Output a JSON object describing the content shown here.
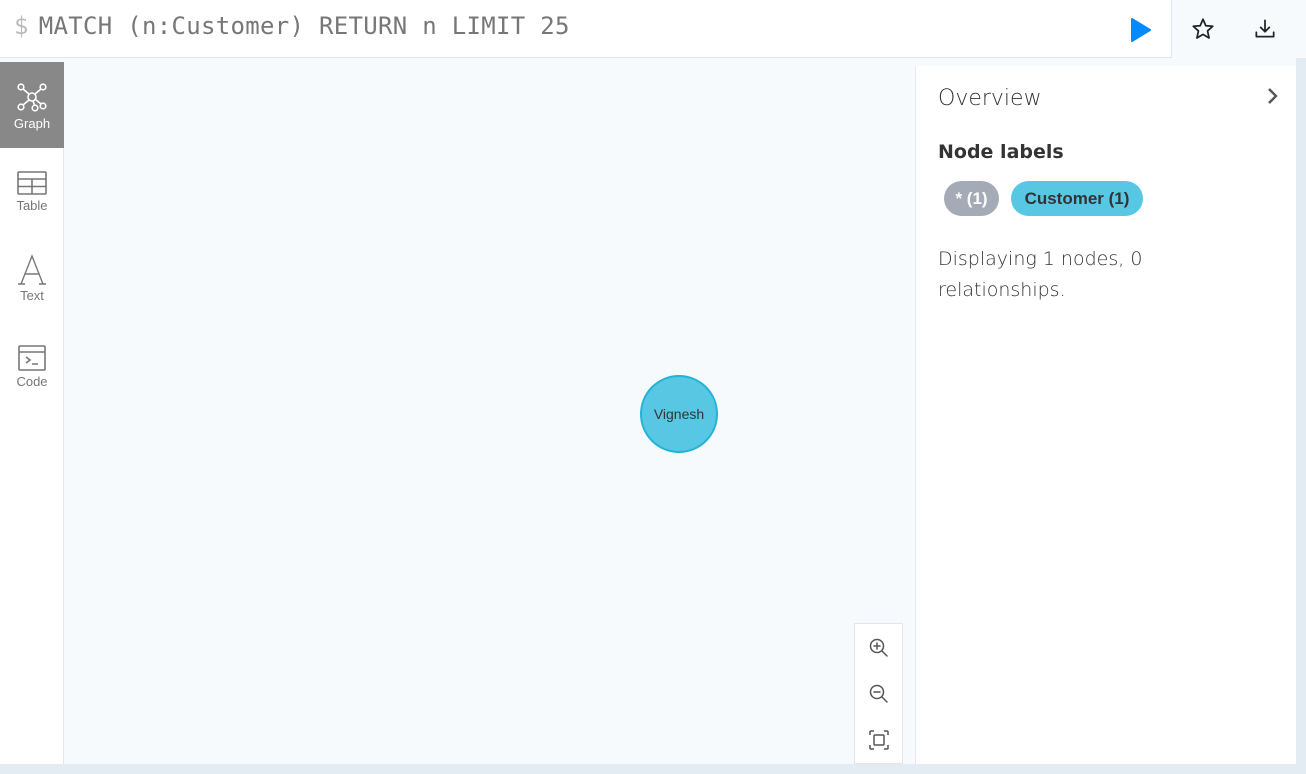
{
  "editor": {
    "prompt": "$",
    "query": "MATCH (n:Customer) RETURN n LIMIT 25",
    "run_icon": "play-icon",
    "favorite_icon": "star-icon",
    "download_icon": "download-icon",
    "accent_color": "#018bff"
  },
  "sidebar": {
    "items": [
      {
        "label": "Graph",
        "icon": "graph-icon",
        "active": true
      },
      {
        "label": "Table",
        "icon": "table-icon",
        "active": false
      },
      {
        "label": "Text",
        "icon": "text-icon",
        "active": false
      },
      {
        "label": "Code",
        "icon": "code-icon",
        "active": false
      }
    ]
  },
  "graph": {
    "nodes": [
      {
        "caption": "Vignesh",
        "label": "Customer",
        "color": "#57c7e3",
        "border_color": "#23b3d7"
      }
    ],
    "zoom_controls": [
      "zoom-in-icon",
      "zoom-out-icon",
      "fit-to-screen-icon"
    ]
  },
  "overview": {
    "title": "Overview",
    "collapse_icon": "chevron-right-icon",
    "node_labels_heading": "Node labels",
    "labels": [
      {
        "text": "* (1)",
        "color": "#a5abb6"
      },
      {
        "text": "Customer (1)",
        "color": "#57c7e3"
      }
    ],
    "summary": "Displaying 1 nodes, 0 relationships."
  }
}
